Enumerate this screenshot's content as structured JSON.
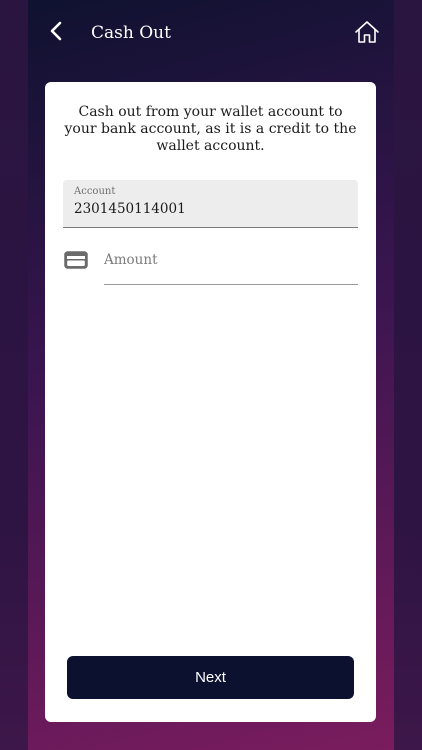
{
  "header": {
    "title": "Cash Out",
    "back_icon": "chevron-left-icon",
    "home_icon": "home-icon"
  },
  "form": {
    "description": "Cash out from your wallet account to your bank account, as it is a credit to the wallet account.",
    "account": {
      "label": "Account",
      "value": "2301450114001"
    },
    "amount": {
      "placeholder": "Amount",
      "value": "",
      "icon": "credit-card-icon"
    },
    "next_label": "Next"
  },
  "colors": {
    "button_bg": "#0d1130",
    "card_bg": "#ffffff",
    "field_bg": "#ededed",
    "gradient_start": "#0f1230",
    "gradient_end": "#7a1c5e"
  }
}
